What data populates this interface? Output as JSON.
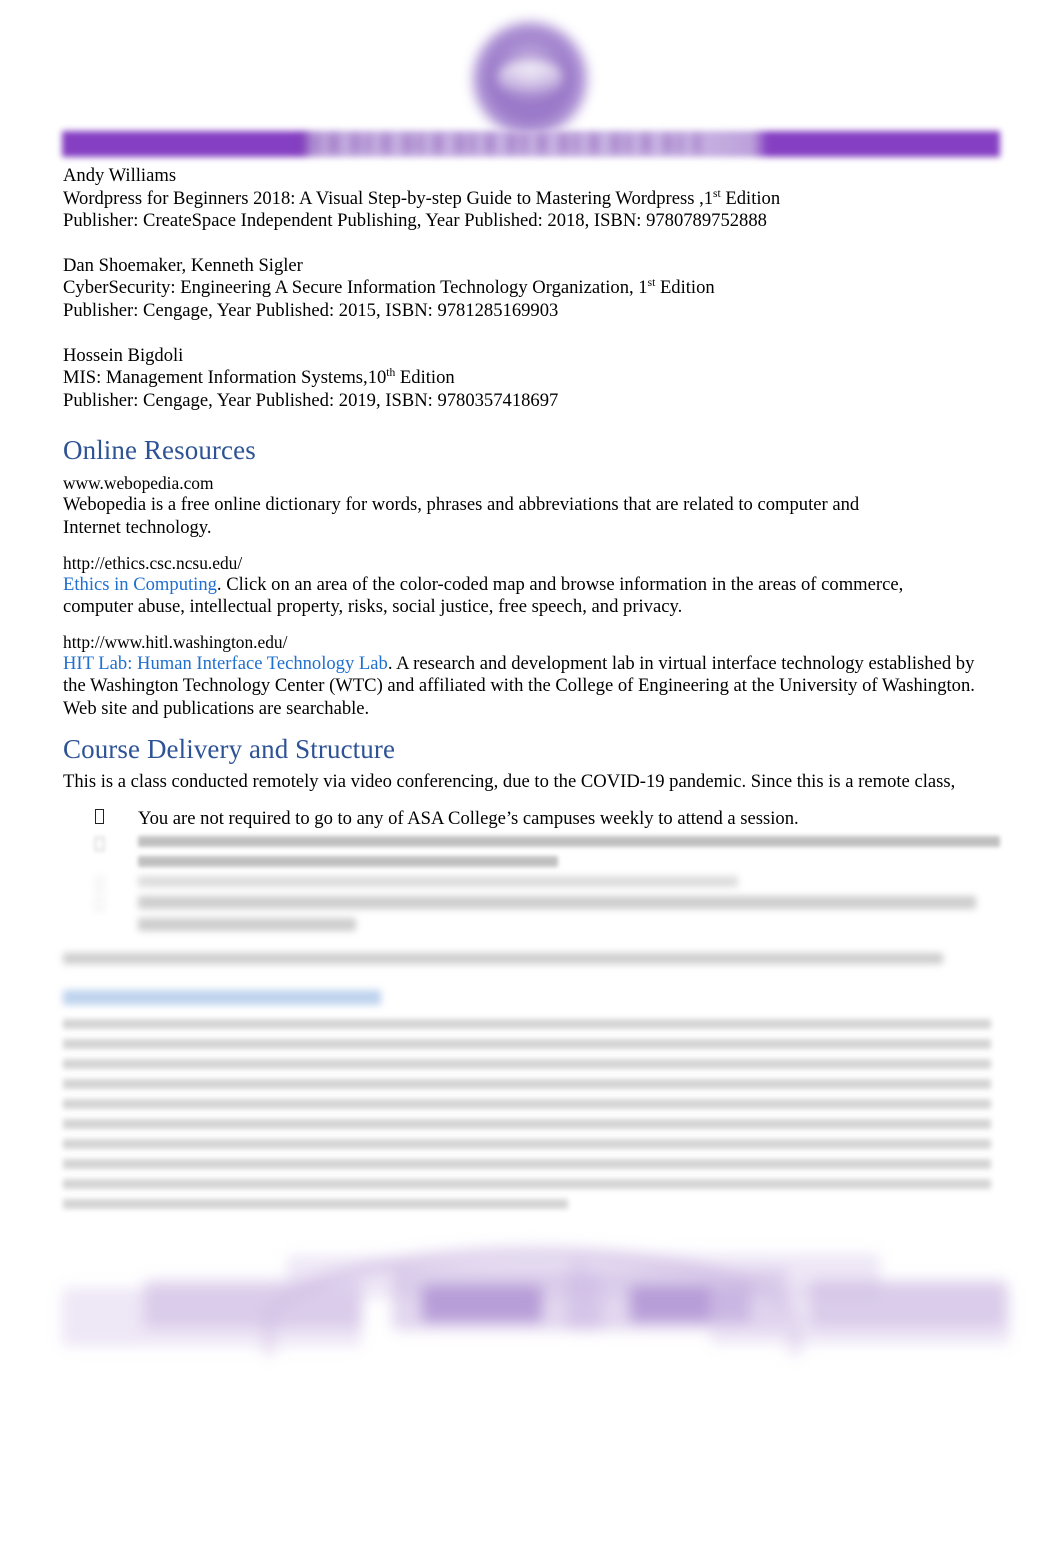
{
  "document": {
    "header": {
      "logo_name": "asa-college-seal-logo",
      "banner_color": "#7b2fbe",
      "banner_mid_color": "#c3abe0"
    },
    "references": [
      {
        "author": "Andy Williams",
        "title_prefix": "Wordpress for Beginners 2018: A Visual Step-by-step Guide to Mastering Wordpress ,1",
        "edition_sup": "st",
        "title_suffix": " Edition",
        "publication": "Publisher: CreateSpace Independent Publishing, Year Published: 2018, ISBN: 9780789752888"
      },
      {
        "author": "Dan Shoemaker, Kenneth Sigler",
        "title_prefix": "CyberSecurity: Engineering A Secure Information Technology Organization,  1",
        "edition_sup": "st",
        "title_suffix": " Edition",
        "publication": "Publisher: Cengage, Year Published: 2015, ISBN: 9781285169903"
      },
      {
        "author": "Hossein Bigdoli",
        "title_prefix": "MIS: Management Information Systems,10",
        "edition_sup": "th",
        "title_suffix": " Edition",
        "publication": "Publisher: Cengage, Year Published: 2019, ISBN: 9780357418697"
      }
    ],
    "online_resources": {
      "heading": "Online Resources",
      "heading_color": "#2E5395",
      "link_color": "#1F6FD0",
      "entries": [
        {
          "url": "www.webopedia.com",
          "link_text": "",
          "description_line1": "Webopedia is a free online dictionary for words, phrases and abbreviations that are related to computer and",
          "description_line2": "Internet technology."
        },
        {
          "url": "http://ethics.csc.ncsu.edu/",
          "link_text": "Ethics in Computing",
          "description_line1": ". Click on an area of the color-coded map and browse information in the areas of commerce,",
          "description_line2": "computer abuse, intellectual property, risks, social justice, free speech, and privacy."
        },
        {
          "url": "http://www.hitl.washington.edu/",
          "link_text": "HIT Lab: Human Interface Technology Lab",
          "description_line1": ". A research and development lab in virtual interface technology established by",
          "description_line2": "the Washington Technology Center (WTC) and affiliated with the College of Engineering at the University of Washington.",
          "description_line3": "Web site and publications are searchable."
        }
      ]
    },
    "course_delivery": {
      "heading": "Course Delivery and Structure",
      "heading_color": "#2E5395",
      "intro": "This is a class conducted remotely via video conferencing, due to the COVID-19 pandemic. Since this is a remote class,",
      "bullet_marker": "missing-glyph-box",
      "bullets": [
        "You are not required to go to any of ASA College’s campuses weekly to attend a session."
      ],
      "redacted_bullets_count": 3,
      "redacted_paragraph_present": true,
      "redacted_heading_present": true
    },
    "footer": {
      "graphic_name": "blurred-purple-footer-graphic",
      "color": "#cbb6e2"
    }
  }
}
